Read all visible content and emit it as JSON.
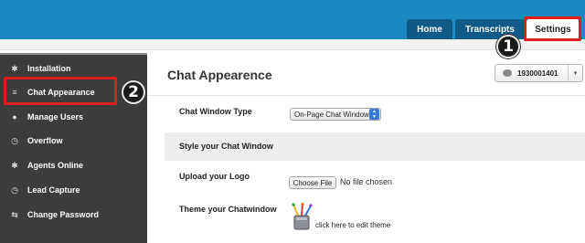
{
  "header": {
    "tabs": [
      {
        "label": "Home"
      },
      {
        "label": "Transcripts"
      },
      {
        "label": "Settings"
      }
    ]
  },
  "sidebar": {
    "items": [
      {
        "label": "Installation",
        "icon": "gear-icon"
      },
      {
        "label": "Chat Appearance",
        "icon": "list-icon"
      },
      {
        "label": "Manage Users",
        "icon": "user-icon"
      },
      {
        "label": "Overflow",
        "icon": "clock-icon"
      },
      {
        "label": "Agents Online",
        "icon": "gear-icon"
      },
      {
        "label": "Lead Capture",
        "icon": "clock-icon"
      },
      {
        "label": "Change Password",
        "icon": "refresh-icon"
      }
    ]
  },
  "annotations": {
    "badge1": "1",
    "badge2": "2",
    "highlight_color": "#e21b1b"
  },
  "main": {
    "title": "Chat Appearence",
    "user_selector": {
      "value": "1930001401"
    },
    "chat_window_type": {
      "label": "Chat Window Type",
      "value": "On-Page Chat Window"
    },
    "style_section_title": "Style your Chat Window",
    "upload_logo": {
      "label": "Upload your Logo",
      "button": "Choose File",
      "status": "No file chosen"
    },
    "theme": {
      "label": "Theme your Chatwindow",
      "link": "click here to edit theme"
    }
  },
  "colors": {
    "header_blue": "#1a8ac0",
    "tab_dark": "#0f5a86",
    "sidebar_bg": "#3c3c3c"
  }
}
